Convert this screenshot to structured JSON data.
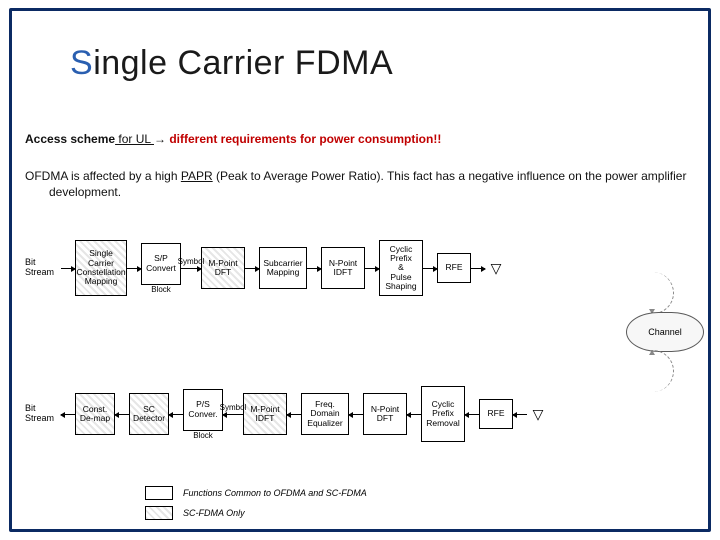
{
  "title": {
    "s": "S",
    "rest": "ingle Carrier FDMA"
  },
  "intro": {
    "lead": "Access scheme",
    "for_ul": " for UL ",
    "arrow": "→",
    "tail": " different requirements for power consumption!!"
  },
  "desc": {
    "p1a": "OFDMA is affected by a high ",
    "papr": "PAPR",
    "p1b": " (Peak to Average Power Ratio). This fact has a negative influence on the power amplifier development."
  },
  "diagram": {
    "tx": {
      "input": "Bit\nStream",
      "scm": "Single\nCarrier\nConstellation\nMapping",
      "sp": "S/P\nConvert",
      "sp_sub": "Block",
      "lbl_symbol": "Symbol",
      "dft": "M-Point\nDFT",
      "map": "Subcarrier\nMapping",
      "idft": "N-Point\nIDFT",
      "cp": "Cyclic\nPrefix\n&\nPulse\nShaping",
      "rfe": "RFE"
    },
    "rx": {
      "output": "Bit\nStream",
      "demap": "Const.\nDe-map",
      "scdet": "SC\nDetector",
      "ps": "P/S\nConver.",
      "ps_sub": "Block",
      "lbl_symbol": "Symbol",
      "idft": "M-Point\nIDFT",
      "eq": "Freq.\nDomain\nEqualizer",
      "dft": "N-Point\nDFT",
      "cprm": "Cyclic\nPrefix\nRemoval",
      "rfe": "RFE"
    },
    "channel": "Channel",
    "legend": {
      "common": "Functions Common to OFDMA and SC-FDMA",
      "sconly": "SC-FDMA Only"
    }
  }
}
